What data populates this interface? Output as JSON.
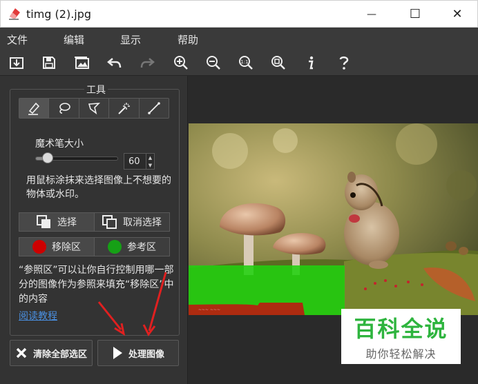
{
  "window": {
    "title": "timg (2).jpg",
    "minimize": "—",
    "maximize": "☐",
    "close": "✕"
  },
  "menu": {
    "items": [
      "文件",
      "编辑",
      "显示",
      "帮助"
    ]
  },
  "toolbar": {
    "icons": [
      "open-icon",
      "save-icon",
      "image-icon",
      "undo-icon",
      "redo-icon",
      "zoom-in-icon",
      "zoom-out-icon",
      "actual-size-icon",
      "fit-window-icon",
      "info-icon",
      "help-icon"
    ]
  },
  "tools": {
    "group_title": "工具",
    "active_tool": "brush",
    "brush_size_label": "魔术笔大小",
    "brush_size_value": "60",
    "brush_size_fraction": 0.12,
    "hint": "用鼠标涂抹来选择图像上不想要的物体或水印。",
    "select_label": "选择",
    "deselect_label": "取消选择",
    "remove_area_label": "移除区",
    "reference_area_label": "参考区",
    "remove_color": "#cc0000",
    "reference_color": "#16a016",
    "description": "“参照区”可以让你自行控制用哪一部分的图像作为参照来填充“移除区”中的内容",
    "tutorial_link": "阅读教程"
  },
  "actions": {
    "clear_all": "清除全部选区",
    "process": "处理图像"
  },
  "watermark": {
    "main": "百科全说",
    "sub": "助你轻松解决"
  }
}
